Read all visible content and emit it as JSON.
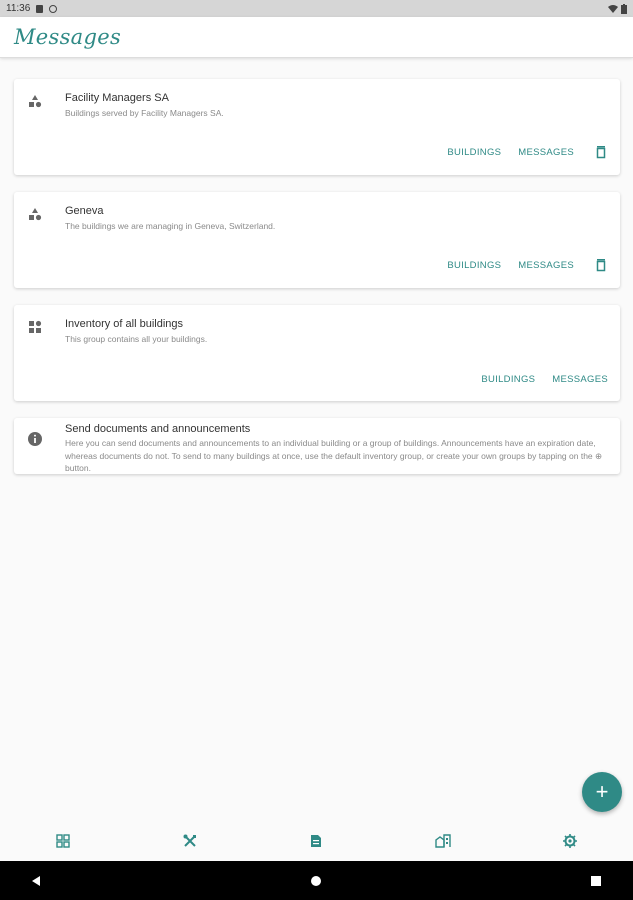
{
  "status_bar": {
    "time": "11:36"
  },
  "app_bar": {
    "title": "Messages"
  },
  "groups": [
    {
      "title": "Facility Managers SA",
      "description": "Buildings served by Facility Managers SA.",
      "icon": "shapes-icon",
      "buildings_label": "BUILDINGS",
      "messages_label": "MESSAGES",
      "deletable": true
    },
    {
      "title": "Geneva",
      "description": "The buildings we are managing in Geneva, Switzerland.",
      "icon": "shapes-icon",
      "buildings_label": "BUILDINGS",
      "messages_label": "MESSAGES",
      "deletable": true
    },
    {
      "title": "Inventory of all buildings",
      "description": "This group contains all your buildings.",
      "icon": "inventory-icon",
      "buildings_label": "BUILDINGS",
      "messages_label": "MESSAGES",
      "deletable": false
    }
  ],
  "info_card": {
    "title": "Send documents and announcements",
    "description": "Here you can send documents and announcements to an individual building or a group of buildings. Announcements have an expiration date, whereas documents do not. To send to many buildings at once, use the default inventory group, or create your own groups by tapping on the ⊕ button.",
    "icon": "info-icon"
  },
  "fab": {
    "label": "+",
    "icon": "add-icon"
  },
  "bottom_nav": [
    {
      "name": "dashboard",
      "icon": "dashboard-icon"
    },
    {
      "name": "tools",
      "icon": "tools-icon"
    },
    {
      "name": "messages",
      "icon": "document-icon"
    },
    {
      "name": "buildings",
      "icon": "buildings-icon"
    },
    {
      "name": "settings",
      "icon": "settings-icon"
    }
  ],
  "colors": {
    "accent": "#2f8a86",
    "background": "#fafafa",
    "card": "#ffffff",
    "status_bar": "#d6d6d6"
  }
}
